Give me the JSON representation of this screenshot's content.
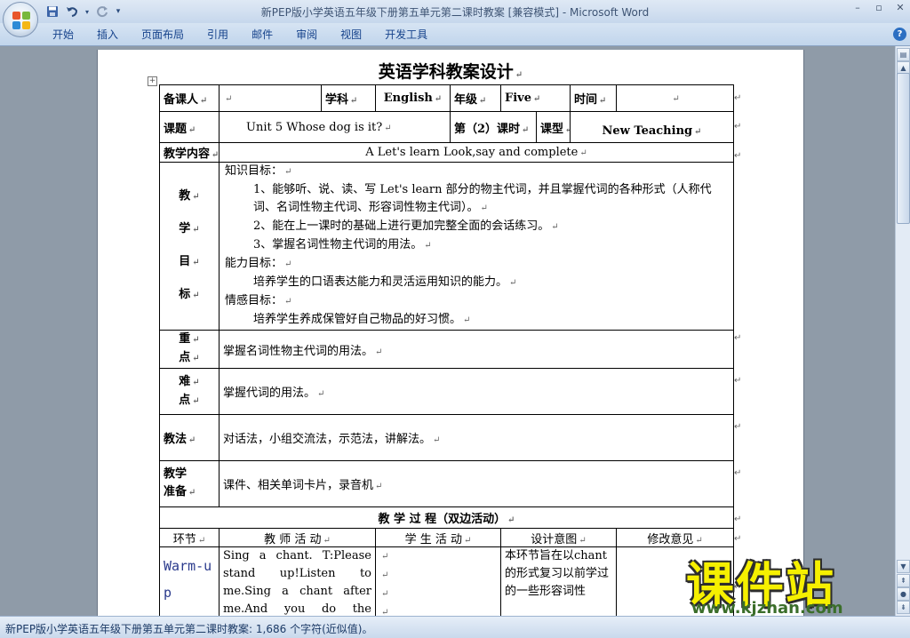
{
  "window": {
    "title": "新PEP版小学英语五年级下册第五单元第二课时教案 [兼容模式] - Microsoft Word",
    "controls": {
      "minimize": "–",
      "restore": "▫",
      "close": "✕"
    }
  },
  "quick_access": {
    "save_icon": "save-icon",
    "undo_icon": "undo-icon",
    "redo_icon": "redo-icon",
    "customize_icon": "customize-icon"
  },
  "ribbon": {
    "tabs": [
      "开始",
      "插入",
      "页面布局",
      "引用",
      "邮件",
      "审阅",
      "视图",
      "开发工具"
    ],
    "help": "?"
  },
  "document": {
    "title": "英语学科教案设计",
    "para_mark": "↵",
    "row1": {
      "teacher_label": "备课人",
      "teacher_value": "",
      "subject_label": "学科",
      "subject_value": "English",
      "grade_label": "年级",
      "grade_value": "Five",
      "time_label": "时间",
      "time_value": ""
    },
    "row2": {
      "topic_label": "课题",
      "topic_value": "Unit 5      Whose dog is it?",
      "lesson_label": "第（2）课时",
      "type_label": "课型",
      "type_value": "New Teaching"
    },
    "row3": {
      "content_label": "教学内容",
      "content_value": "A Let's learn        Look,say and complete"
    },
    "objectives": {
      "label_chars": [
        "教",
        "学",
        "目",
        "标"
      ],
      "knowledge_head": "知识目标：",
      "k1": "1、能够听、说、读、写 Let's learn 部分的物主代词，并且掌握代词的各种形式（人称代词、名词性物主代词、形容词性物主代词）。",
      "k2": "2、能在上一课时的基础上进行更加完整全面的会话练习。",
      "k3": "3、掌握名词性物主代词的用法。",
      "ability_head": "能力目标：",
      "a1": "培养学生的口语表达能力和灵活运用知识的能力。",
      "emotion_head": "情感目标：",
      "e1": "培养学生养成保管好自己物品的好习惯。"
    },
    "key_points": {
      "label_1": "重",
      "label_2": "点",
      "value": "掌握名词性物主代词的用法。"
    },
    "difficult_points": {
      "label_1": "难",
      "label_2": "点",
      "value": "掌握代词的用法。"
    },
    "methods": {
      "label": "教法",
      "value": "对话法，小组交流法，示范法，讲解法。"
    },
    "preparation": {
      "label_1": "教学",
      "label_2": "准备",
      "value": "课件、相关单词卡片，录音机"
    },
    "process": {
      "title": "教      学      过      程（双边活动）",
      "headers": [
        "环节",
        "教 师 活 动",
        "学 生 活 动",
        "设计意图",
        "修改意见"
      ],
      "stage": "Warm-up",
      "teacher_activity": "Sing a chant. T:Please stand up!Listen to me.Sing a chant after me.And you do the actions.Here we go!",
      "design_intent": "本环节旨在以chant 的形式复习以前学过的一些形容词性"
    }
  },
  "status": {
    "text": "新PEP版小学英语五年级下册第五单元第二课时教案: 1,686 个字符(近似值)。"
  },
  "watermark": {
    "main": "课件站",
    "url": "www.kjzhan.com"
  }
}
